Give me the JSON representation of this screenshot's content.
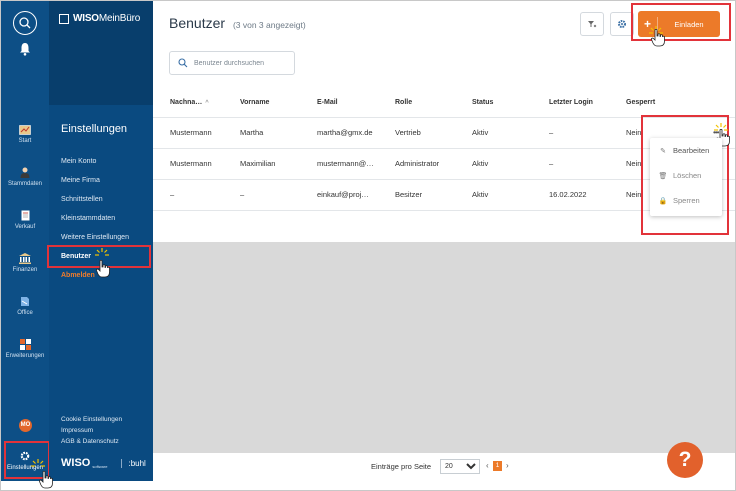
{
  "app": {
    "name_bold": "WISO",
    "name_rest": "MeinBüro"
  },
  "rail": {
    "items": [
      {
        "label": "Start"
      },
      {
        "label": "Stammdaten"
      },
      {
        "label": "Verkauf"
      },
      {
        "label": "Finanzen"
      },
      {
        "label": "Office"
      },
      {
        "label": "Erweiterungen"
      }
    ],
    "avatar": "MO",
    "settings_label": "Einstellungen"
  },
  "settings_nav": {
    "title": "Einstellungen",
    "items": [
      "Mein Konto",
      "Meine Firma",
      "Schnittstellen",
      "Kleinstammdaten",
      "Weitere Einstellungen",
      "Benutzer",
      "Abmelden"
    ],
    "active": "Benutzer",
    "footer_links": [
      "Cookie Einstellungen",
      "Impressum",
      "AGB & Datenschutz"
    ],
    "brand": "WISO",
    "brand_sub": "software",
    "brand_partner": ":buhl"
  },
  "header": {
    "title": "Benutzer",
    "count": "(3 von 3 angezeigt)",
    "invite_plus": "+",
    "invite_label": "Einladen"
  },
  "search": {
    "placeholder": "Benutzer durchsuchen",
    "value": ""
  },
  "table": {
    "columns": [
      "Nachna…",
      "Vorname",
      "E-Mail",
      "Rolle",
      "Status",
      "Letzter Login",
      "Gesperrt"
    ],
    "sort_indicator": "^",
    "rows": [
      [
        "Mustermann",
        "Martha",
        "martha@gmx.de",
        "Vertrieb",
        "Aktiv",
        "–",
        "Nein"
      ],
      [
        "Mustermann",
        "Maximilian",
        "mustermann@…",
        "Administrator",
        "Aktiv",
        "–",
        "Nein"
      ],
      [
        "–",
        "–",
        "einkauf@proj…",
        "Besitzer",
        "Aktiv",
        "16.02.2022",
        "Nein"
      ]
    ]
  },
  "context_menu": {
    "trigger": "•••",
    "items": [
      "Bearbeiten",
      "Löschen",
      "Sperren"
    ]
  },
  "pagination": {
    "label": "Einträge pro Seite",
    "per_page": "20",
    "options": [
      "20"
    ],
    "prev": "‹",
    "current_page": "1",
    "next": "›"
  },
  "help_label": "?",
  "colors": {
    "rail_bg": "#0d4f86",
    "sidebar_bg": "#0a4a80",
    "accent": "#ec7a29",
    "highlight": "#e2333a",
    "help": "#e2612c"
  }
}
